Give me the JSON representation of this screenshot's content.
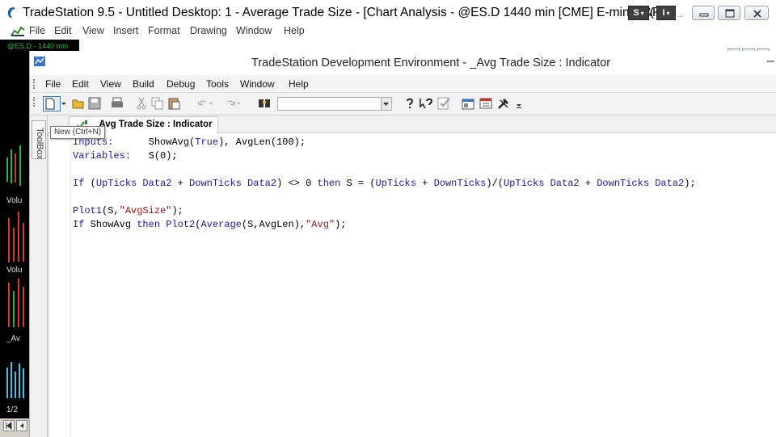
{
  "app": {
    "title": "TradeStation 9.5 - Untitled Desktop: 1 - Average Trade Size - [Chart Analysis - @ES.D 1440 min [CME] E-mini S&P",
    "title_extra": "(",
    "ellipsis": "...",
    "symbol_btn": "S",
    "interval_btn": "I",
    "dropdown_glyph": "▾",
    "menu": [
      "File",
      "Edit",
      "View",
      "Insert",
      "Format",
      "Drawing",
      "Window",
      "Help"
    ]
  },
  "chart": {
    "symbol_label": "@ES.D - 1440 min",
    "labels": [
      "Volu",
      "Volu",
      "_Av",
      "1/2"
    ],
    "bar_colors": {
      "up": "#1db954",
      "down": "#d33a2c",
      "avg": "#38c6e8"
    }
  },
  "dev": {
    "title": "TradeStation Development Environment - _Avg Trade Size : Indicator",
    "dash": "–",
    "menu": [
      "File",
      "Edit",
      "View",
      "Build",
      "Debug",
      "Tools",
      "Window",
      "Help"
    ],
    "toolbox_label": "ToolBox",
    "tab_label": "_Avg Trade Size : Indicator",
    "tooltip": "New (Ctrl+N)",
    "code": {
      "line1_kw": "Inputs:",
      "line1_rest_a": "ShowAvg(",
      "line1_val_a": "True",
      "line1_rest_b": "), AvgLen(100);",
      "line2_kw": "Variables:",
      "line2_rest": "S(0);",
      "line4_if": "If",
      "line4_a": "(",
      "line4_up": "UpTicks Data2",
      "line4_plus": " + ",
      "line4_down": "DownTicks Data2",
      "line4_b": ") <> 0 ",
      "line4_then": "then",
      "line4_c": " S = (",
      "line4_up2": "UpTicks",
      "line4_plus2": " + ",
      "line4_down2": "DownTicks",
      "line4_d": ")/(",
      "line4_up3": "UpTicks Data2",
      "line4_plus3": " + ",
      "line4_down3": "DownTicks Data2",
      "line4_e": ");",
      "line6_fn": "Plot1",
      "line6_a": "(S,",
      "line6_str": "\"AvgSize\"",
      "line6_b": ");",
      "line7_if": "If",
      "line7_a": " ShowAvg ",
      "line7_then": "then",
      "line7_fn": " Plot2",
      "line7_b": "(",
      "line7_fn2": "Average",
      "line7_c": "(S,AvgLen),",
      "line7_str": "\"Avg\"",
      "line7_d": ");"
    }
  }
}
